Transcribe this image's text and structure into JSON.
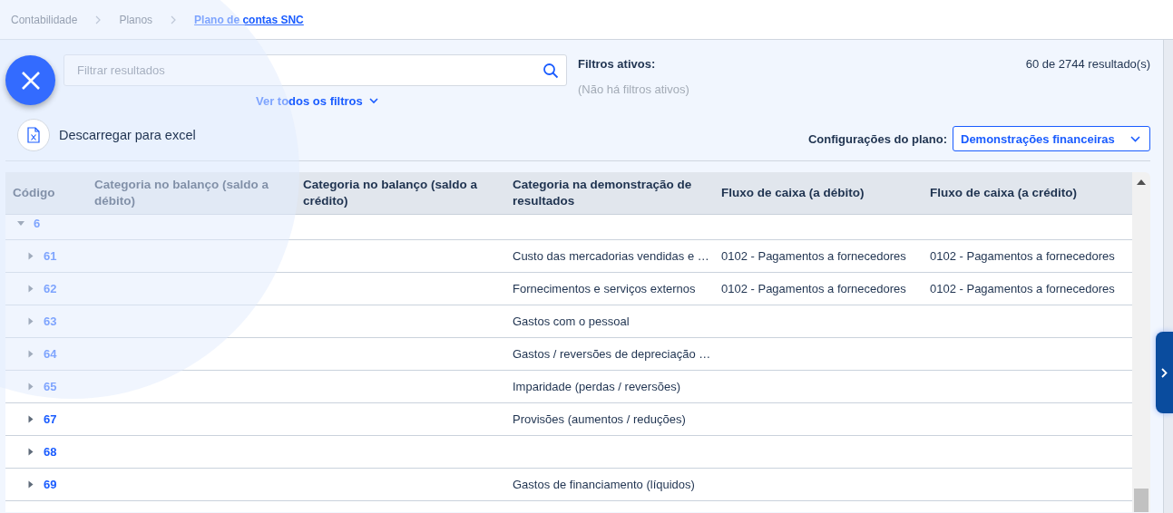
{
  "breadcrumb": [
    {
      "label": "Contabilidade",
      "current": false
    },
    {
      "label": "Planos",
      "current": false
    },
    {
      "label": "Plano de contas SNC",
      "current": true
    }
  ],
  "search": {
    "placeholder": "Filtrar resultados"
  },
  "filters_link": "Ver todos os filtros",
  "active_filters": {
    "title": "Filtros ativos:",
    "empty_message": "(Não há filtros ativos)"
  },
  "result_count": "60 de 2744 resultado(s)",
  "plan_config": {
    "label": "Configurações do plano:",
    "value": "Demonstrações financeiras"
  },
  "table": {
    "columns": [
      "Código",
      "Categoria no balanço (saldo a débito)",
      "Categoria no balanço (saldo a crédito)",
      "Categoria na demonstração de resultados",
      "Fluxo de caixa (a débito)",
      "Fluxo de caixa (a crédito)"
    ],
    "rows": [
      {
        "code": "6",
        "expanded": true,
        "children": [
          {
            "code": "61",
            "expanded": false,
            "income_statement": "Custo das mercadorias vendidas e …",
            "cash_flow_debit": "0102 - Pagamentos a fornecedores",
            "cash_flow_credit": "0102 - Pagamentos a fornecedores"
          },
          {
            "code": "62",
            "expanded": false,
            "income_statement": "Fornecimentos e serviços externos",
            "cash_flow_debit": "0102 - Pagamentos a fornecedores",
            "cash_flow_credit": "0102 - Pagamentos a fornecedores"
          },
          {
            "code": "63",
            "expanded": false,
            "income_statement": "Gastos com o pessoal"
          },
          {
            "code": "64",
            "expanded": false,
            "income_statement": "Gastos / reversões de depreciação …"
          },
          {
            "code": "65",
            "expanded": false,
            "income_statement": "Imparidade (perdas / reversões)"
          },
          {
            "code": "67",
            "expanded": false,
            "income_statement": "Provisões (aumentos / reduções)"
          },
          {
            "code": "68",
            "expanded": false
          },
          {
            "code": "69",
            "expanded": false,
            "income_statement": "Gastos de financiamento (líquidos)"
          }
        ]
      }
    ]
  },
  "action_menu": {
    "actions": [
      {
        "label": "Descarregar para excel"
      }
    ]
  }
}
